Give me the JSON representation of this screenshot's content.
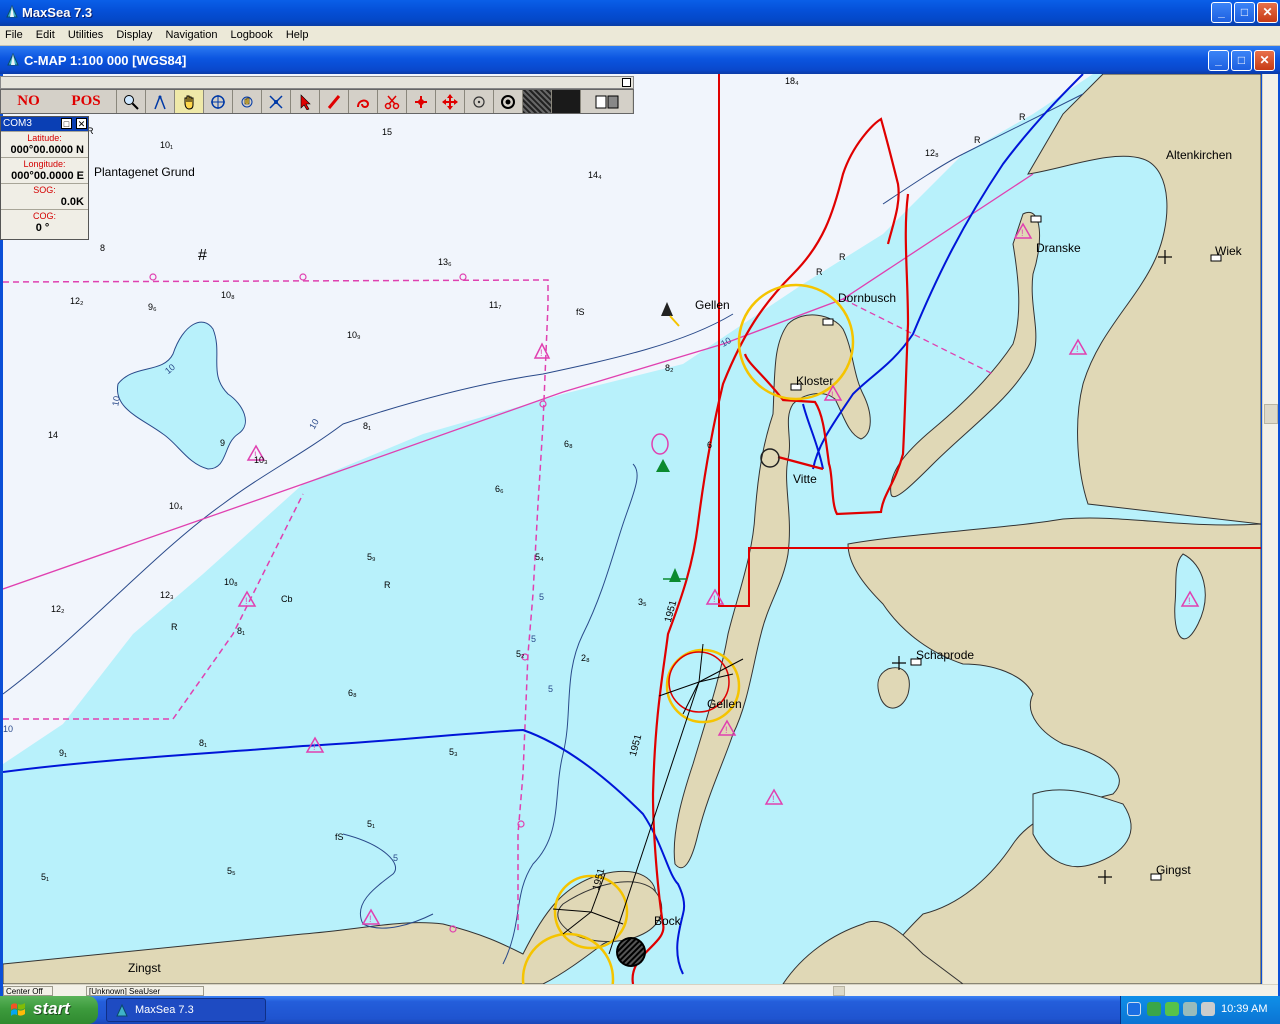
{
  "window": {
    "title": "MaxSea 7.3"
  },
  "menu": [
    "File",
    "Edit",
    "Utilities",
    "Display",
    "Navigation",
    "Logbook",
    "Help"
  ],
  "doc": {
    "title": "C-MAP  1:100 000 [WGS84]"
  },
  "toolbar": {
    "status_no": "NO",
    "status_pos": "POS",
    "tools": [
      "zoom-icon",
      "compass-icon",
      "hand-icon",
      "crosshair-icon",
      "move-icon",
      "scale-icon",
      "pointer-icon",
      "pencil-icon",
      "route-icon",
      "scissors-icon",
      "cursor-icon",
      "expand-icon",
      "circle-icon",
      "target-icon",
      "pattern-icon",
      "black-icon",
      "window-icon"
    ]
  },
  "com_panel": {
    "title": "COM3",
    "latitude_label": "Latitude:",
    "latitude_value": "000°00.0000 N",
    "longitude_label": "Longitude:",
    "longitude_value": "000°00.0000 E",
    "sog_label": "SOG:",
    "sog_value": "0.0K",
    "cog_label": "COG:",
    "cog_value": "0 °"
  },
  "places": {
    "plantagenet": "Plantagenet Grund",
    "altenkirchen": "Altenkirchen",
    "dranske": "Dranske",
    "wiek": "Wiek",
    "dornbusch": "Dornbusch",
    "gellen_n": "Gellen",
    "kloster": "Kloster",
    "vitte": "Vitte",
    "schaprode": "Schaprode",
    "gellen_s": "Gellen",
    "gingst": "Gingst",
    "bock": "Bock",
    "zingst": "Zingst"
  },
  "depths": {
    "d1": "18₄",
    "d2": "10₁",
    "d3": "15",
    "d4": "14₄",
    "d5": "12₈",
    "d6": "8",
    "d7": "13₆",
    "d8": "12₂",
    "d9": "10₈",
    "d10": "11₇",
    "d11": "fS",
    "d12": "9₆",
    "d13": "10₉",
    "d14": "14",
    "d15": "9",
    "d16": "10₃",
    "d17": "8₁",
    "d18": "8₂",
    "d19": "6₈",
    "d20": "6",
    "d21": "6₆",
    "d22": "10₄",
    "d23": "5₉",
    "d24": "5₄",
    "d25": "R",
    "d26": "10₈",
    "d27": "12₃",
    "d28": "12₂",
    "d29": "Cb",
    "d30": "R",
    "d31": "8₁",
    "d32": "3₅",
    "d33": "5₂",
    "d34": "2₈",
    "d35": "6₈",
    "d36": "9₁",
    "d37": "8₁",
    "d38": "5₃",
    "d39": "fS",
    "d40": "5₁",
    "d41": "5₁",
    "d42": "5₅",
    "d43": "R",
    "d44": "R",
    "d45": "R",
    "d46": "R",
    "d47": "R"
  },
  "contours": {
    "c10a": "10",
    "c10b": "10",
    "c10c": "10",
    "c5a": "5",
    "c5b": "5",
    "c5c": "5",
    "c5d": "5",
    "c10d": "10",
    "c1951a": "1951",
    "c1951b": "1951",
    "c1951c": "1951",
    "c10e": "10"
  },
  "statusbar": {
    "cell1": "Center Off",
    "cell2": "[Unknown] SeaUser"
  },
  "taskbar": {
    "start_label": "start",
    "task_label": "MaxSea 7.3",
    "clock": "10:39 AM"
  },
  "colors": {
    "water": "#b8f1fb",
    "deep_water": "#f1f5fc",
    "land": "#e0d8b6",
    "route_red": "#e00000",
    "route_blue": "#0016d8",
    "boundary_magenta": "#e040b0",
    "yellow_circle": "#f5c400"
  }
}
